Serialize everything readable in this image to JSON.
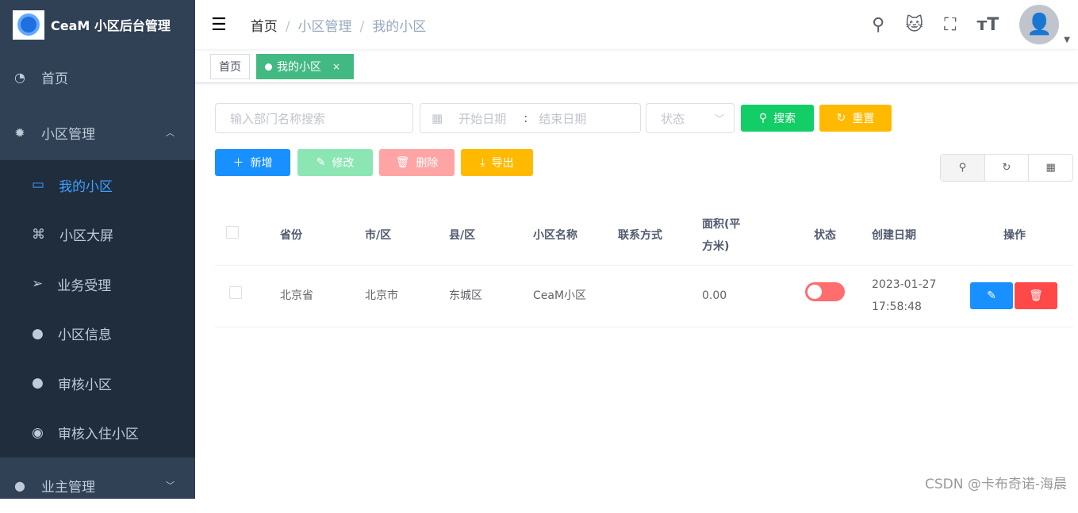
{
  "app": {
    "title": "CeaM 小区后台管理"
  },
  "sidebar": {
    "home": "首页",
    "group1": "小区管理",
    "items": [
      {
        "label": "我的小区",
        "icon": "shopping-icon"
      },
      {
        "label": "小区大屏",
        "icon": "grid-icon"
      },
      {
        "label": "业务受理",
        "icon": "send-icon"
      },
      {
        "label": "小区信息",
        "icon": "users-icon"
      },
      {
        "label": "审核小区",
        "icon": "users-icon"
      },
      {
        "label": "审核入住小区",
        "icon": "wechat-icon"
      }
    ],
    "group2": "业主管理"
  },
  "breadcrumb": [
    "首页",
    "小区管理",
    "我的小区"
  ],
  "tags": {
    "home": "首页",
    "active": "我的小区",
    "close": "×"
  },
  "search": {
    "name_placeholder": "输入部门名称搜索",
    "start_placeholder": "开始日期",
    "sep": ":",
    "end_placeholder": "结束日期",
    "status_placeholder": "状态",
    "search": "搜索",
    "reset": "重置"
  },
  "toolbar": {
    "add": "新增",
    "edit": "修改",
    "delete": "删除",
    "export": "导出"
  },
  "table": {
    "headers": [
      "省份",
      "市/区",
      "县/区",
      "小区名称",
      "联系方式",
      "面积(平方米)",
      "状态",
      "创建日期",
      "操作"
    ],
    "rows": [
      {
        "province": "北京省",
        "city": "北京市",
        "county": "东城区",
        "name": "CeaM小区",
        "contact": "",
        "area": "0.00",
        "status": false,
        "date": "2023-01-27",
        "time": "17:58:48"
      }
    ]
  },
  "colors": {
    "primary": "#1890ff",
    "success": "#13ce66",
    "warning": "#ffba00",
    "danger": "#ff4949"
  },
  "watermark": "CSDN @卡布奇诺-海晨"
}
